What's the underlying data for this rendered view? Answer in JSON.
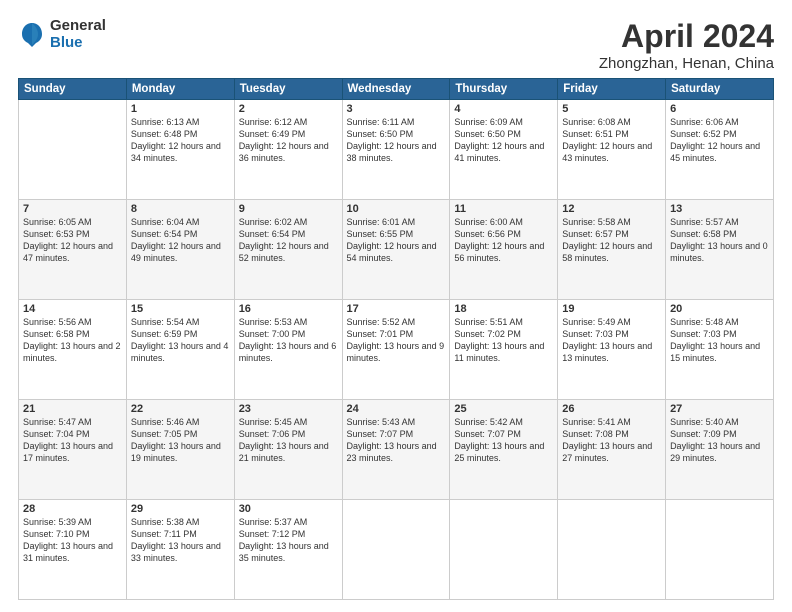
{
  "header": {
    "logo_general": "General",
    "logo_blue": "Blue",
    "title": "April 2024",
    "subtitle": "Zhongzhan, Henan, China"
  },
  "calendar": {
    "weekdays": [
      "Sunday",
      "Monday",
      "Tuesday",
      "Wednesday",
      "Thursday",
      "Friday",
      "Saturday"
    ],
    "weeks": [
      [
        {
          "day": "",
          "sunrise": "",
          "sunset": "",
          "daylight": ""
        },
        {
          "day": "1",
          "sunrise": "Sunrise: 6:13 AM",
          "sunset": "Sunset: 6:48 PM",
          "daylight": "Daylight: 12 hours and 34 minutes."
        },
        {
          "day": "2",
          "sunrise": "Sunrise: 6:12 AM",
          "sunset": "Sunset: 6:49 PM",
          "daylight": "Daylight: 12 hours and 36 minutes."
        },
        {
          "day": "3",
          "sunrise": "Sunrise: 6:11 AM",
          "sunset": "Sunset: 6:50 PM",
          "daylight": "Daylight: 12 hours and 38 minutes."
        },
        {
          "day": "4",
          "sunrise": "Sunrise: 6:09 AM",
          "sunset": "Sunset: 6:50 PM",
          "daylight": "Daylight: 12 hours and 41 minutes."
        },
        {
          "day": "5",
          "sunrise": "Sunrise: 6:08 AM",
          "sunset": "Sunset: 6:51 PM",
          "daylight": "Daylight: 12 hours and 43 minutes."
        },
        {
          "day": "6",
          "sunrise": "Sunrise: 6:06 AM",
          "sunset": "Sunset: 6:52 PM",
          "daylight": "Daylight: 12 hours and 45 minutes."
        }
      ],
      [
        {
          "day": "7",
          "sunrise": "Sunrise: 6:05 AM",
          "sunset": "Sunset: 6:53 PM",
          "daylight": "Daylight: 12 hours and 47 minutes."
        },
        {
          "day": "8",
          "sunrise": "Sunrise: 6:04 AM",
          "sunset": "Sunset: 6:54 PM",
          "daylight": "Daylight: 12 hours and 49 minutes."
        },
        {
          "day": "9",
          "sunrise": "Sunrise: 6:02 AM",
          "sunset": "Sunset: 6:54 PM",
          "daylight": "Daylight: 12 hours and 52 minutes."
        },
        {
          "day": "10",
          "sunrise": "Sunrise: 6:01 AM",
          "sunset": "Sunset: 6:55 PM",
          "daylight": "Daylight: 12 hours and 54 minutes."
        },
        {
          "day": "11",
          "sunrise": "Sunrise: 6:00 AM",
          "sunset": "Sunset: 6:56 PM",
          "daylight": "Daylight: 12 hours and 56 minutes."
        },
        {
          "day": "12",
          "sunrise": "Sunrise: 5:58 AM",
          "sunset": "Sunset: 6:57 PM",
          "daylight": "Daylight: 12 hours and 58 minutes."
        },
        {
          "day": "13",
          "sunrise": "Sunrise: 5:57 AM",
          "sunset": "Sunset: 6:58 PM",
          "daylight": "Daylight: 13 hours and 0 minutes."
        }
      ],
      [
        {
          "day": "14",
          "sunrise": "Sunrise: 5:56 AM",
          "sunset": "Sunset: 6:58 PM",
          "daylight": "Daylight: 13 hours and 2 minutes."
        },
        {
          "day": "15",
          "sunrise": "Sunrise: 5:54 AM",
          "sunset": "Sunset: 6:59 PM",
          "daylight": "Daylight: 13 hours and 4 minutes."
        },
        {
          "day": "16",
          "sunrise": "Sunrise: 5:53 AM",
          "sunset": "Sunset: 7:00 PM",
          "daylight": "Daylight: 13 hours and 6 minutes."
        },
        {
          "day": "17",
          "sunrise": "Sunrise: 5:52 AM",
          "sunset": "Sunset: 7:01 PM",
          "daylight": "Daylight: 13 hours and 9 minutes."
        },
        {
          "day": "18",
          "sunrise": "Sunrise: 5:51 AM",
          "sunset": "Sunset: 7:02 PM",
          "daylight": "Daylight: 13 hours and 11 minutes."
        },
        {
          "day": "19",
          "sunrise": "Sunrise: 5:49 AM",
          "sunset": "Sunset: 7:03 PM",
          "daylight": "Daylight: 13 hours and 13 minutes."
        },
        {
          "day": "20",
          "sunrise": "Sunrise: 5:48 AM",
          "sunset": "Sunset: 7:03 PM",
          "daylight": "Daylight: 13 hours and 15 minutes."
        }
      ],
      [
        {
          "day": "21",
          "sunrise": "Sunrise: 5:47 AM",
          "sunset": "Sunset: 7:04 PM",
          "daylight": "Daylight: 13 hours and 17 minutes."
        },
        {
          "day": "22",
          "sunrise": "Sunrise: 5:46 AM",
          "sunset": "Sunset: 7:05 PM",
          "daylight": "Daylight: 13 hours and 19 minutes."
        },
        {
          "day": "23",
          "sunrise": "Sunrise: 5:45 AM",
          "sunset": "Sunset: 7:06 PM",
          "daylight": "Daylight: 13 hours and 21 minutes."
        },
        {
          "day": "24",
          "sunrise": "Sunrise: 5:43 AM",
          "sunset": "Sunset: 7:07 PM",
          "daylight": "Daylight: 13 hours and 23 minutes."
        },
        {
          "day": "25",
          "sunrise": "Sunrise: 5:42 AM",
          "sunset": "Sunset: 7:07 PM",
          "daylight": "Daylight: 13 hours and 25 minutes."
        },
        {
          "day": "26",
          "sunrise": "Sunrise: 5:41 AM",
          "sunset": "Sunset: 7:08 PM",
          "daylight": "Daylight: 13 hours and 27 minutes."
        },
        {
          "day": "27",
          "sunrise": "Sunrise: 5:40 AM",
          "sunset": "Sunset: 7:09 PM",
          "daylight": "Daylight: 13 hours and 29 minutes."
        }
      ],
      [
        {
          "day": "28",
          "sunrise": "Sunrise: 5:39 AM",
          "sunset": "Sunset: 7:10 PM",
          "daylight": "Daylight: 13 hours and 31 minutes."
        },
        {
          "day": "29",
          "sunrise": "Sunrise: 5:38 AM",
          "sunset": "Sunset: 7:11 PM",
          "daylight": "Daylight: 13 hours and 33 minutes."
        },
        {
          "day": "30",
          "sunrise": "Sunrise: 5:37 AM",
          "sunset": "Sunset: 7:12 PM",
          "daylight": "Daylight: 13 hours and 35 minutes."
        },
        {
          "day": "",
          "sunrise": "",
          "sunset": "",
          "daylight": ""
        },
        {
          "day": "",
          "sunrise": "",
          "sunset": "",
          "daylight": ""
        },
        {
          "day": "",
          "sunrise": "",
          "sunset": "",
          "daylight": ""
        },
        {
          "day": "",
          "sunrise": "",
          "sunset": "",
          "daylight": ""
        }
      ]
    ]
  }
}
